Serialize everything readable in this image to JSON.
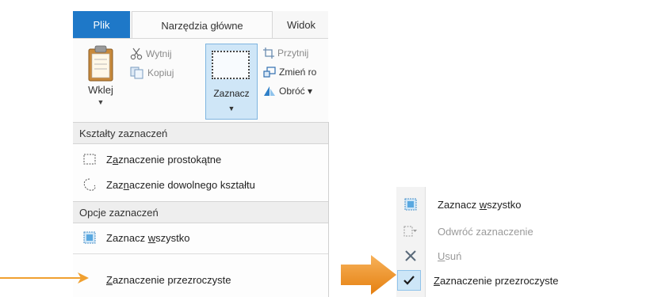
{
  "ribbon": {
    "tabs": [
      "Plik",
      "Narzędzia główne",
      "Widok"
    ],
    "clipboard": {
      "paste_label": "Wklej",
      "cut_label": "Wytnij",
      "copy_label": "Kopiuj"
    },
    "image": {
      "select_label": "Zaznacz",
      "crop_label": "Przytnij",
      "resize_label": "Zmień ro",
      "rotate_label": "Obróć ▾"
    }
  },
  "select_menu": {
    "shapes_header": "Kształty zaznaczeń",
    "rect_pre": "Z",
    "rect_u": "a",
    "rect_post": "znaczenie prostokątne",
    "free_pre": "Zaz",
    "free_u": "n",
    "free_post": "aczenie dowolnego kształtu",
    "options_header": "Opcje zaznaczeń",
    "all_pre": "Zaznacz ",
    "all_u": "w",
    "all_post": "szystko",
    "transparent_pre": "",
    "transparent_u": "Z",
    "transparent_post": "aznaczenie przezroczyste"
  },
  "context_menu": {
    "select_all_pre": "Zaznacz ",
    "select_all_u": "w",
    "select_all_post": "szystko",
    "invert_label": "Odwróć zaznaczenie",
    "delete_u": "U",
    "delete_post": "suń",
    "transparent_u": "Z",
    "transparent_post": "aznaczenie przezroczyste"
  },
  "colors": {
    "file_tab": "#1e78c8",
    "highlight": "#cfe6f7",
    "arrow_orange": "#f0a030"
  }
}
